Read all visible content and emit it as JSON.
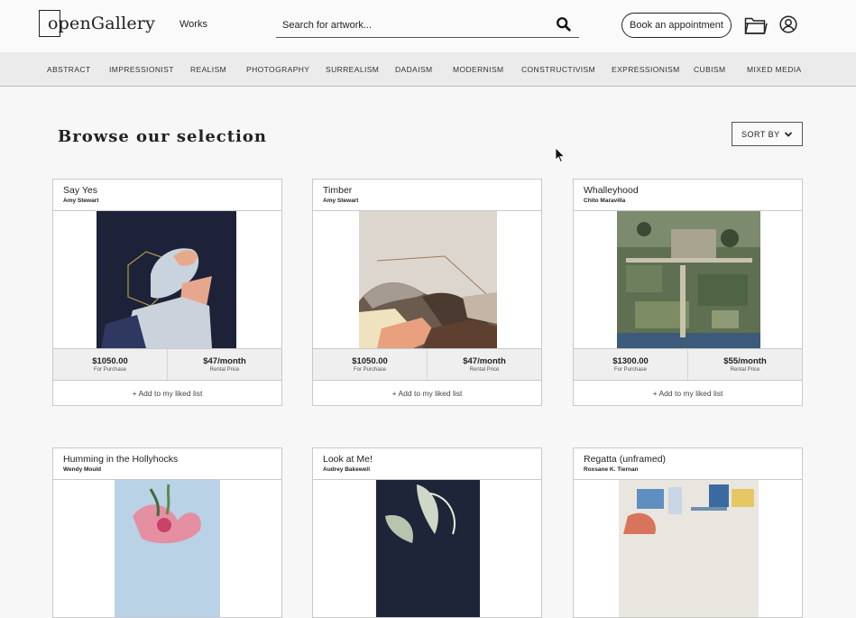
{
  "header": {
    "logo_text": "openGallery",
    "nav_works": "Works",
    "search_placeholder": "Search for artwork...",
    "book_label": "Book an appointment"
  },
  "categories": [
    "ABSTRACT",
    "IMPRESSIONIST",
    "REALISM",
    "PHOTOGRAPHY",
    "SURREALISM",
    "DADAISM",
    "MODERNISM",
    "CONSTRUCTIVISM",
    "EXPRESSIONISM",
    "CUBISM",
    "MIXED MEDIA"
  ],
  "main": {
    "title": "Browse our selection",
    "sort_label": "SORT BY"
  },
  "cards": [
    {
      "title": "Say Yes",
      "artist": "Amy Stewart",
      "purchase": "$1050.00",
      "purchase_label": "For Purchase",
      "rental": "$47/month",
      "rental_label": "Rental Price",
      "like": "+ Add to my liked list"
    },
    {
      "title": "Timber",
      "artist": "Amy Stewart",
      "purchase": "$1050.00",
      "purchase_label": "For Purchase",
      "rental": "$47/month",
      "rental_label": "Rental Price",
      "like": "+ Add to my liked list"
    },
    {
      "title": "Whalleyhood",
      "artist": "Chito Maravilla",
      "purchase": "$1300.00",
      "purchase_label": "For Purchase",
      "rental": "$55/month",
      "rental_label": "Rental Price",
      "like": "+ Add to my liked list"
    },
    {
      "title": "Humming in the Hollyhocks",
      "artist": "Wendy Mould"
    },
    {
      "title": "Look at Me!",
      "artist": "Audrey Bakewell"
    },
    {
      "title": "Regatta (unframed)",
      "artist": "Roxsane K. Tiernan"
    }
  ],
  "colors": {
    "accent": "#222222",
    "bar": "#ebebeb",
    "price_bg": "#efefef"
  }
}
